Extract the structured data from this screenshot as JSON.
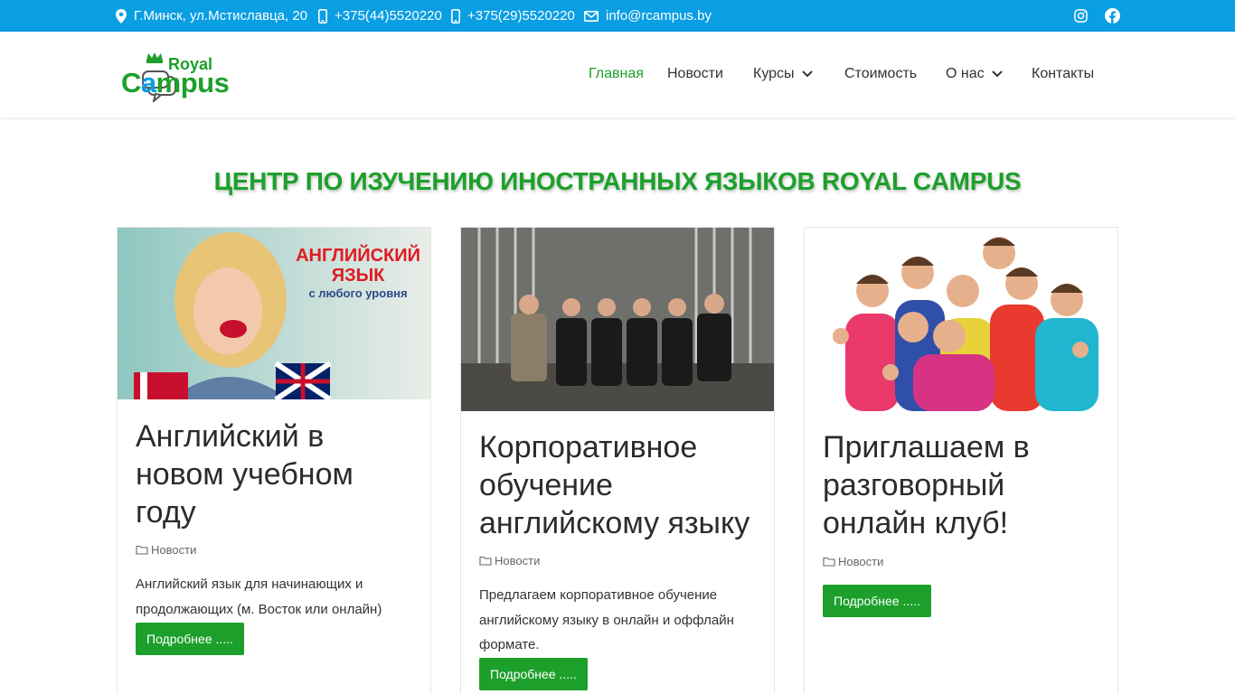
{
  "topbar": {
    "address": "Г.Минск, ул.Мстиславца, 20",
    "phone1": "+375(44)5520220",
    "phone2": "+375(29)5520220",
    "email": "info@rcampus.by"
  },
  "logo": {
    "line1": "Royal",
    "line2a": "C",
    "line2b": "a",
    "line2c": "mpus"
  },
  "nav": {
    "home": "Главная",
    "news": "Новости",
    "courses": "Курсы",
    "price": "Стоимость",
    "about": "О нас",
    "contacts": "Контакты"
  },
  "headline": "ЦЕНТР ПО ИЗУЧЕНИЮ ИНОСТРАННЫХ ЯЗЫКОВ ROYAL CAMPUS",
  "cards": [
    {
      "banner_line1": "АНГЛИЙСКИЙ",
      "banner_line2": "ЯЗЫК",
      "banner_line3": "с любого уровня",
      "title": "Английский в новом учебном году",
      "category": "Новости",
      "text": "Английский язык для начинающих и продолжающих (м. Восток или онлайн)",
      "button": "Подробнее ....."
    },
    {
      "title": "Корпоративное обучение английскому языку",
      "category": "Новости",
      "text": "Предлагаем корпоративное обучение английскому языку в онлайн и оффлайн формате.",
      "button": "Подробнее ....."
    },
    {
      "title": "Приглашаем в разговорный онлайн клуб!",
      "category": "Новости",
      "button": "Подробнее ....."
    }
  ],
  "colors": {
    "topbar": "#0a9ee3",
    "accent": "#1da02b",
    "banner_red": "#e01b22"
  },
  "icons": [
    "map-marker-icon",
    "mobile-phone-icon",
    "envelope-icon",
    "instagram-icon",
    "facebook-icon",
    "chevron-down-icon",
    "folder-icon"
  ]
}
